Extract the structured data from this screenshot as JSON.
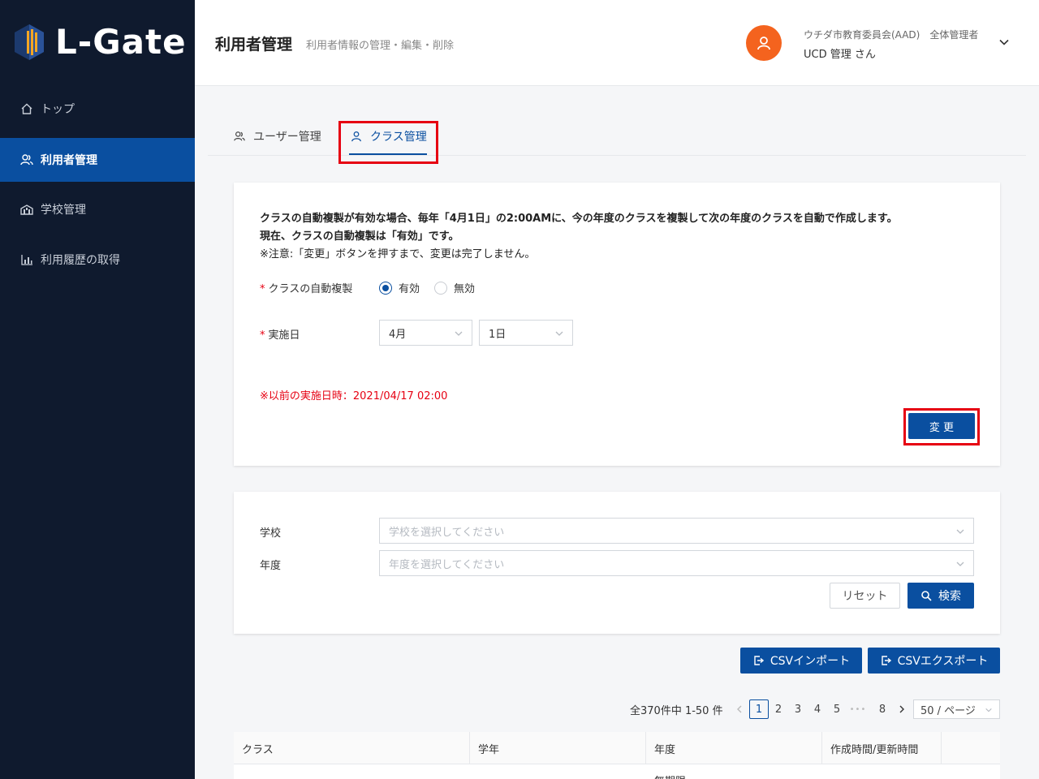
{
  "app": {
    "brand": "L-Gate",
    "brand_color": "#0f1a2e",
    "accent": "#0a4fa0",
    "alert": "#e60012",
    "avatar_color": "#f4631e"
  },
  "sidebar": {
    "items": [
      {
        "label": "トップ",
        "icon": "home-icon"
      },
      {
        "label": "利用者管理",
        "icon": "users-icon",
        "active": true
      },
      {
        "label": "学校管理",
        "icon": "school-icon"
      },
      {
        "label": "利用履歴の取得",
        "icon": "bar-chart-icon"
      }
    ]
  },
  "header": {
    "title": "利用者管理",
    "subtitle": "利用者情報の管理・編集・削除",
    "user_org": "ウチダ市教育委員会(AAD)　全体管理者",
    "user_name": "UCD 管理 さん"
  },
  "tabs": [
    {
      "label": "ユーザー管理",
      "icon": "users-icon"
    },
    {
      "label": "クラス管理",
      "icon": "user-icon",
      "active": true
    }
  ],
  "auto_copy": {
    "info_line1": "クラスの自動複製が有効な場合、毎年「4月1日」の2:00AMに、今の年度のクラスを複製して次の年度のクラスを自動で作成します。",
    "info_line2": "現在、クラスの自動複製は「有効」です。",
    "info_line3": "※注意:「変更」ボタンを押すまで、変更は完了しません。",
    "required_mark": "*",
    "toggle_label": "クラスの自動複製",
    "option_enabled": "有効",
    "option_disabled": "無効",
    "selected": "enabled",
    "date_label": "実施日",
    "month_value": "4月",
    "day_value": "1日",
    "previous_run": "※以前の実施日時：2021/04/17 02:00",
    "change_button": "変 更"
  },
  "search": {
    "school_label": "学校",
    "school_placeholder": "学校を選択してください",
    "year_label": "年度",
    "year_placeholder": "年度を選択してください",
    "reset_button": "リセット",
    "search_button": "検索"
  },
  "csv": {
    "import_button": "CSVインポート",
    "export_button": "CSVエクスポート"
  },
  "pagination": {
    "summary": "全370件中 1-50 件",
    "pages": [
      "1",
      "2",
      "3",
      "4",
      "5",
      "8"
    ],
    "current": "1",
    "ellipsis": "•••",
    "page_size": "50 / ページ"
  },
  "table": {
    "columns": [
      "クラス",
      "学年",
      "年度",
      "作成時間/更新時間"
    ],
    "first_row_year": "無期限"
  }
}
